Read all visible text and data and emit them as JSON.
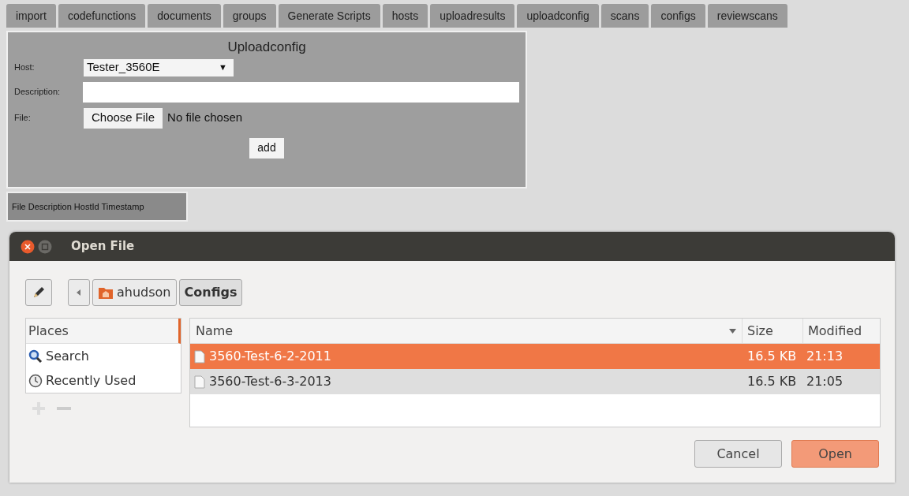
{
  "tabs": [
    {
      "label": "import"
    },
    {
      "label": "codefunctions"
    },
    {
      "label": "documents"
    },
    {
      "label": "groups"
    },
    {
      "label": "Generate Scripts"
    },
    {
      "label": "hosts"
    },
    {
      "label": "uploadresults"
    },
    {
      "label": "uploadconfig"
    },
    {
      "label": "scans"
    },
    {
      "label": "configs"
    },
    {
      "label": "reviewscans"
    }
  ],
  "form": {
    "title": "Uploadconfig",
    "host_label": "Host:",
    "host_value": "Tester_3560E",
    "host_caret": "▼",
    "description_label": "Description:",
    "file_label": "File:",
    "choose_button": "Choose File",
    "file_status": "No file chosen",
    "add_button": "add"
  },
  "table_header": "File Description HostId Timestamp",
  "dialog": {
    "title": "Open File",
    "path": [
      {
        "label": "ahudson",
        "kind": "home"
      },
      {
        "label": "Configs",
        "kind": "current"
      }
    ],
    "places_header": "Places",
    "places": [
      {
        "label": "Search",
        "kind": "search"
      },
      {
        "label": "Recently Used",
        "kind": "recent"
      }
    ],
    "columns": [
      "Name",
      "Size",
      "Modified"
    ],
    "files": [
      {
        "name": "3560-Test-6-2-2011",
        "size": "16.5 KB",
        "modified": "21:13",
        "selected": true
      },
      {
        "name": "3560-Test-6-3-2013",
        "size": "16.5 KB",
        "modified": "21:05",
        "selected": false
      }
    ],
    "buttons": [
      "Cancel",
      "Open"
    ]
  }
}
